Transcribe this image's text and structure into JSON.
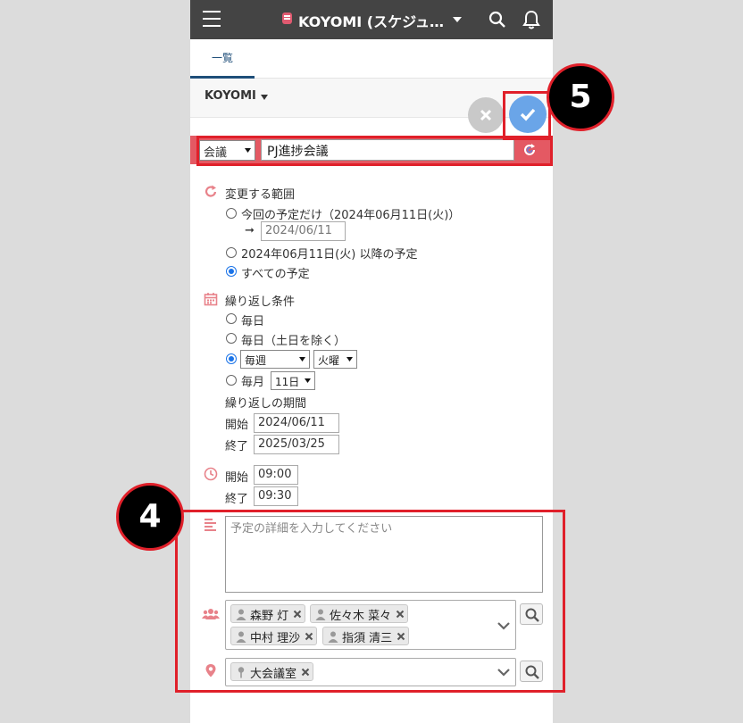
{
  "header": {
    "app_title": "KOYOMI (スケジュ…"
  },
  "tabs": [
    {
      "label": "一覧"
    }
  ],
  "subheader": {
    "calendar_name": "KOYOMI"
  },
  "event": {
    "type": "会議",
    "title": "PJ進捗会議"
  },
  "change_range": {
    "label": "変更する範囲",
    "option_this": "今回の予定だけ（2024年06月11日(火)）",
    "arrow": "➞",
    "this_date": "2024/06/11",
    "option_after": "2024年06月11日(火) 以降の予定",
    "option_all": "すべての予定",
    "selected": "all"
  },
  "repeat": {
    "label": "繰り返し条件",
    "daily": "毎日",
    "weekdays": "毎日（土日を除く）",
    "weekly_select": "毎週",
    "weekday_select": "火曜",
    "monthly": "毎月",
    "monthly_day": "11日",
    "selected": "weekly",
    "period_label": "繰り返しの期間",
    "start_label": "開始",
    "start_value": "2024/06/11",
    "end_label": "終了",
    "end_value": "2025/03/25"
  },
  "time": {
    "start_label": "開始",
    "start_value": "09:00",
    "end_label": "終了",
    "end_value": "09:30"
  },
  "detail": {
    "placeholder": "予定の詳細を入力してください"
  },
  "attendees": [
    "森野 灯",
    "佐々木 菜々",
    "中村 理沙",
    "指須 清三"
  ],
  "facilities": [
    "大会議室"
  ],
  "callouts": {
    "four": "4",
    "five": "5"
  },
  "colors": {
    "topbar": "#444444",
    "accent_red": "#e45963",
    "highlight": "#e0202a",
    "save_blue": "#6aa5e8",
    "tab_blue": "#1f4e79"
  }
}
